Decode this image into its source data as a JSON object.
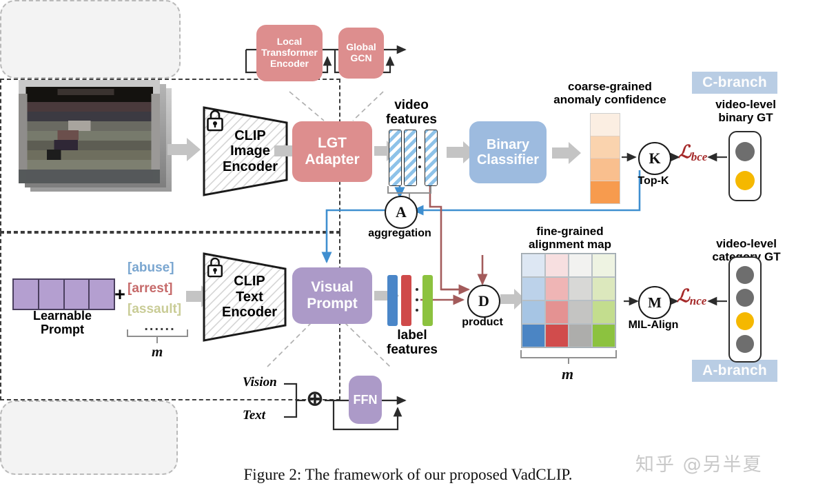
{
  "figure": {
    "caption": "Figure 2: The framework of our proposed VadCLIP.",
    "watermark": "知乎 @另半夏"
  },
  "lgt_panel": {
    "local_block": "Local\nTransformer\nEncoder",
    "local_line1": "Local",
    "local_line2": "Transformer",
    "local_line3": "Encoder",
    "global_line1": "Global",
    "global_line2": "GCN"
  },
  "visual_branch": {
    "image_encoder_line1": "CLIP",
    "image_encoder_line2": "Image",
    "image_encoder_line3": "Encoder",
    "adapter_line1": "LGT",
    "adapter_line2": "Adapter",
    "video_features_line1": "video",
    "video_features_line2": "features"
  },
  "c_branch": {
    "tag": "C-branch",
    "classifier_line1": "Binary",
    "classifier_line2": "Classifier",
    "confidence_line1": "coarse-grained",
    "confidence_line2": "anomaly confidence",
    "topk_symbol": "K",
    "topk_label": "Top-K",
    "loss": "ℒ",
    "loss_sub": "bce",
    "gt_line1": "video-level",
    "gt_line2": "binary GT",
    "confidence_cells": [
      "#fbeee2",
      "#fad3ae",
      "#f9bf8e",
      "#f79b4e"
    ],
    "gt_dots": [
      false,
      true
    ]
  },
  "a_branch": {
    "tag": "A-branch",
    "alignment_line1": "fine-grained",
    "alignment_line2": "alignment map",
    "mil_symbol": "M",
    "mil_label": "MIL-Align",
    "loss": "ℒ",
    "loss_sub": "nce",
    "gt_line1": "video-level",
    "gt_line2": "category GT",
    "gt_dots": [
      false,
      false,
      true,
      false
    ],
    "m_label": "m",
    "alignment_rows": [
      [
        "#dde7f3",
        "#f7dfe0",
        "#f2f2f0",
        "#eef3e2"
      ],
      [
        "#bcd2ea",
        "#efb5b5",
        "#d8d8d6",
        "#dce8bd"
      ],
      [
        "#a6c5e4",
        "#e49292",
        "#c4c4c2",
        "#c3dd8e"
      ],
      [
        "#4b85c4",
        "#d14c4c",
        "#adadab",
        "#8cc23f"
      ]
    ]
  },
  "text_branch": {
    "learnable_prompt_line1": "Learnable",
    "learnable_prompt_line2": "Prompt",
    "plus": "+",
    "classes": [
      {
        "text": "[abuse]",
        "color": "#7aa6d0"
      },
      {
        "text": "[arrest]",
        "color": "#c66a6a"
      },
      {
        "text": "[assault]",
        "color": "#c9cc96"
      }
    ],
    "ellipsis": "......",
    "m_label": "m",
    "text_encoder_line1": "CLIP",
    "text_encoder_line2": "Text",
    "text_encoder_line3": "Encoder",
    "prompt_line1": "Visual",
    "prompt_line2": "Prompt",
    "label_features_line1": "label",
    "label_features_line2": "features",
    "label_bar_colors": [
      "#4a86c8",
      "#cf4a4a",
      "#8cc23f"
    ]
  },
  "operators": {
    "aggregation_symbol": "A",
    "aggregation_label": "aggregation",
    "product_symbol": "D",
    "product_label": "product"
  },
  "ffn_panel": {
    "vision": "Vision",
    "text": "Text",
    "plus_symbol": "⊕",
    "ffn": "FFN"
  },
  "colors": {
    "pink": "#dd8e8e",
    "blue": "#9dbbdf",
    "purple": "#ac9ac8",
    "arrow_grey": "#c4c4c4",
    "blue_line": "#3f8fd0",
    "red_line": "#a35b5b",
    "branch_tag": "#b9cde4"
  }
}
